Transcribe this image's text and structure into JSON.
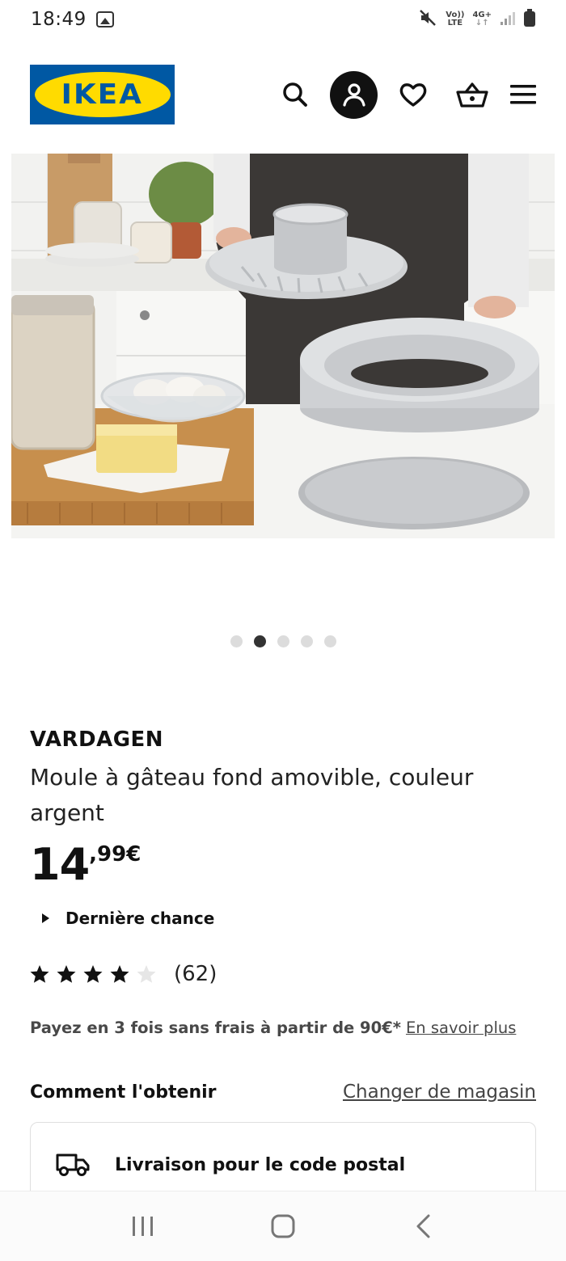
{
  "status_bar": {
    "time": "18:49",
    "network_top": "Vo))",
    "network_bottom": "LTE",
    "data_type": "4G+"
  },
  "header": {
    "logo_text": "IKEA",
    "colors": {
      "logo_blue": "#0058a3",
      "logo_yellow": "#ffdb00"
    },
    "icons": [
      "search-icon",
      "account-icon",
      "heart-icon",
      "basket-icon",
      "menu-icon"
    ]
  },
  "gallery": {
    "total_images": 5,
    "active_index": 1
  },
  "product": {
    "name": "VARDAGEN",
    "description": "Moule à gâteau fond amovible, couleur argent",
    "price_integer": "14",
    "price_decimal": ",99€",
    "last_chance": "Dernière chance",
    "rating": 4,
    "rating_max": 5,
    "review_count": "(62)"
  },
  "installments": {
    "text": "Payez en 3 fois sans frais à partir de 90€*",
    "link": "En savoir plus"
  },
  "obtain": {
    "title": "Comment l'obtenir",
    "change_store": "Changer de magasin",
    "delivery_label": "Livraison pour le code postal"
  },
  "nav": {
    "icons": [
      "recents-icon",
      "home-icon",
      "back-icon"
    ]
  }
}
